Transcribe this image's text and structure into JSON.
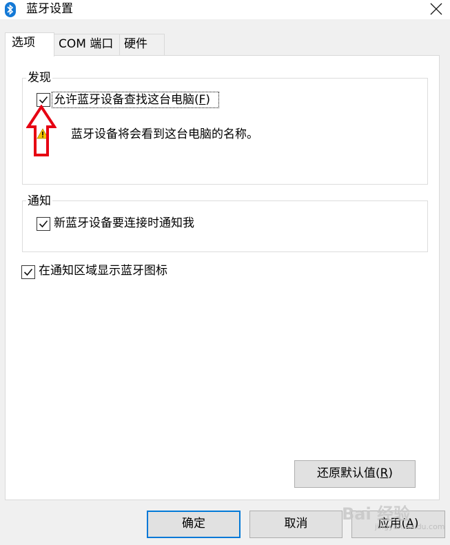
{
  "window": {
    "title": "蓝牙设置"
  },
  "tabs": [
    {
      "label": "选项"
    },
    {
      "label": "COM 端口"
    },
    {
      "label": "硬件"
    }
  ],
  "discovery": {
    "group_label": "发现",
    "allow_checkbox": {
      "label_prefix": "允许蓝牙设备查找这台电脑(",
      "accel": "F",
      "label_suffix": ")",
      "checked": true
    },
    "info_text": "蓝牙设备将会看到这台电脑的名称。"
  },
  "notification": {
    "group_label": "通知",
    "notify_checkbox": {
      "label": "新蓝牙设备要连接时通知我",
      "checked": true
    }
  },
  "tray_checkbox": {
    "label": "在通知区域显示蓝牙图标",
    "checked": true
  },
  "restore_button": {
    "prefix": "还原默认值(",
    "accel": "R",
    "suffix": ")"
  },
  "footer": {
    "ok_label": "确定",
    "cancel_label": "取消",
    "apply_prefix": "应用(",
    "apply_accel": "A",
    "apply_suffix": ")"
  },
  "watermark": {
    "text": "Bai 经验",
    "sub": "jingyan.baidu.com"
  },
  "colors": {
    "accent": "#0078d7",
    "arrow": "#e60012",
    "bluetooth": "#1479d6"
  }
}
